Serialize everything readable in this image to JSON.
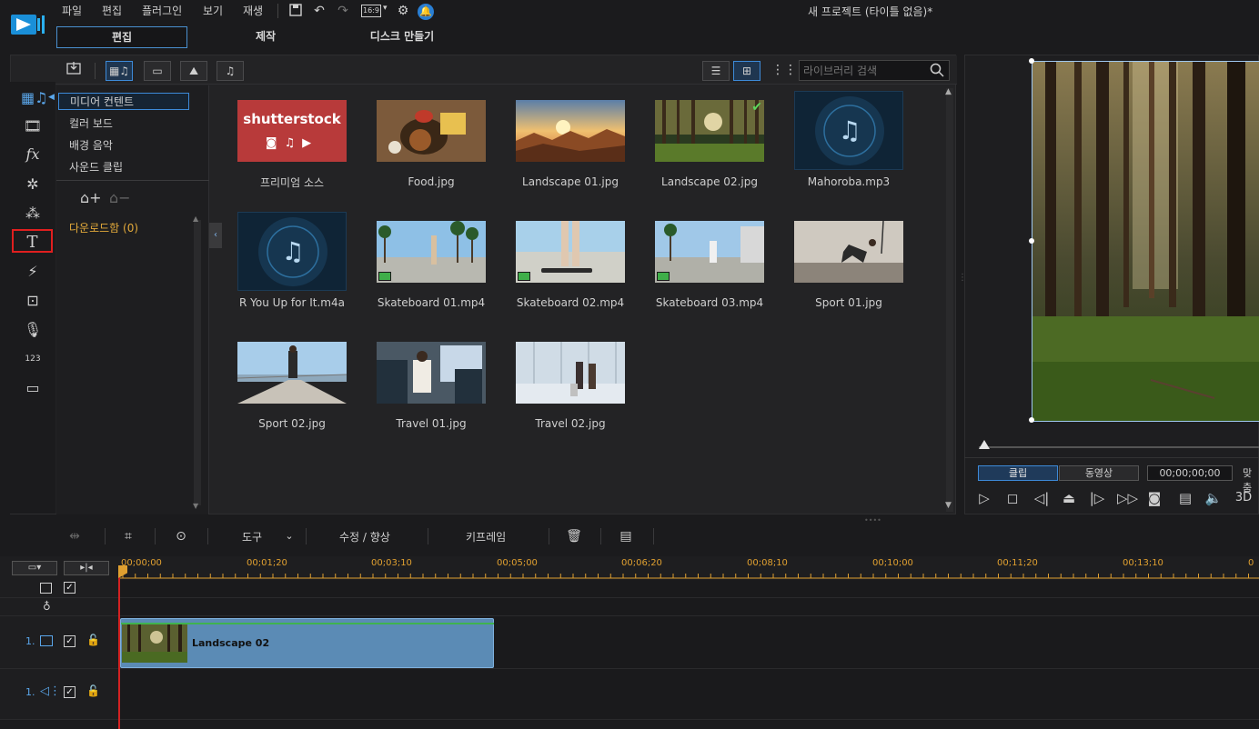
{
  "menu": [
    "파일",
    "편집",
    "플러그인",
    "보기",
    "재생"
  ],
  "toolbar_icons": [
    "save-icon",
    "undo-icon",
    "redo-icon",
    "aspect-ratio-icon",
    "settings-icon",
    "notification-icon"
  ],
  "aspect_ratio": "16:9",
  "window_title": "새 프로젝트 (타이틀 없음)*",
  "mode_tabs": [
    "편집",
    "제작",
    "디스크 만들기"
  ],
  "active_mode": "편집",
  "strip_icons": [
    "media-room-icon",
    "video-room-icon",
    "fx-icon",
    "particle-icon",
    "fire-icon",
    "title-icon",
    "transition-icon",
    "pip-icon",
    "microphone-icon",
    "chapter-icon",
    "subtitle-icon"
  ],
  "categories": [
    "미디어 컨텐트",
    "컬러 보드",
    "배경 음악",
    "사운드 클립"
  ],
  "downloads": "다운로드함  (0)",
  "search": {
    "placeholder": "라이브러리 검색"
  },
  "media": [
    {
      "name": "프리미엄 소스",
      "kind": "shutterstock",
      "logo_text": "shutterstock"
    },
    {
      "name": "Food.jpg",
      "kind": "image"
    },
    {
      "name": "Landscape 01.jpg",
      "kind": "image"
    },
    {
      "name": "Landscape 02.jpg",
      "kind": "image",
      "used": true
    },
    {
      "name": "Mahoroba.mp3",
      "kind": "audio"
    },
    {
      "name": "R You Up for It.m4a",
      "kind": "audio"
    },
    {
      "name": "Skateboard 01.mp4",
      "kind": "video"
    },
    {
      "name": "Skateboard 02.mp4",
      "kind": "video"
    },
    {
      "name": "Skateboard 03.mp4",
      "kind": "video"
    },
    {
      "name": "Sport 01.jpg",
      "kind": "image"
    },
    {
      "name": "Sport 02.jpg",
      "kind": "image"
    },
    {
      "name": "Travel 01.jpg",
      "kind": "image"
    },
    {
      "name": "Travel 02.jpg",
      "kind": "image"
    }
  ],
  "preview": {
    "tabs": [
      "클립",
      "동영상"
    ],
    "active_tab": "클립",
    "timecode": "00;00;00;00",
    "fit": "맞춤",
    "3d": "3D"
  },
  "edit_toolbar": {
    "tools": "도구",
    "fix": "수정 / 향상",
    "keyframe": "키프레임"
  },
  "timeline": {
    "ticks": [
      "00;00;00",
      "00;01;20",
      "00;03;10",
      "00;05;00",
      "00;06;20",
      "00;08;10",
      "00;10;00",
      "00;11;20",
      "00;13;10"
    ],
    "video_track": "1.",
    "audio_track": "1.",
    "clip_name": "Landscape 02"
  },
  "colors": {
    "accent": "#3d8ad8",
    "title_highlight": "#e01f1f",
    "timecode": "#e0a030",
    "clip": "#5b8bb5"
  }
}
